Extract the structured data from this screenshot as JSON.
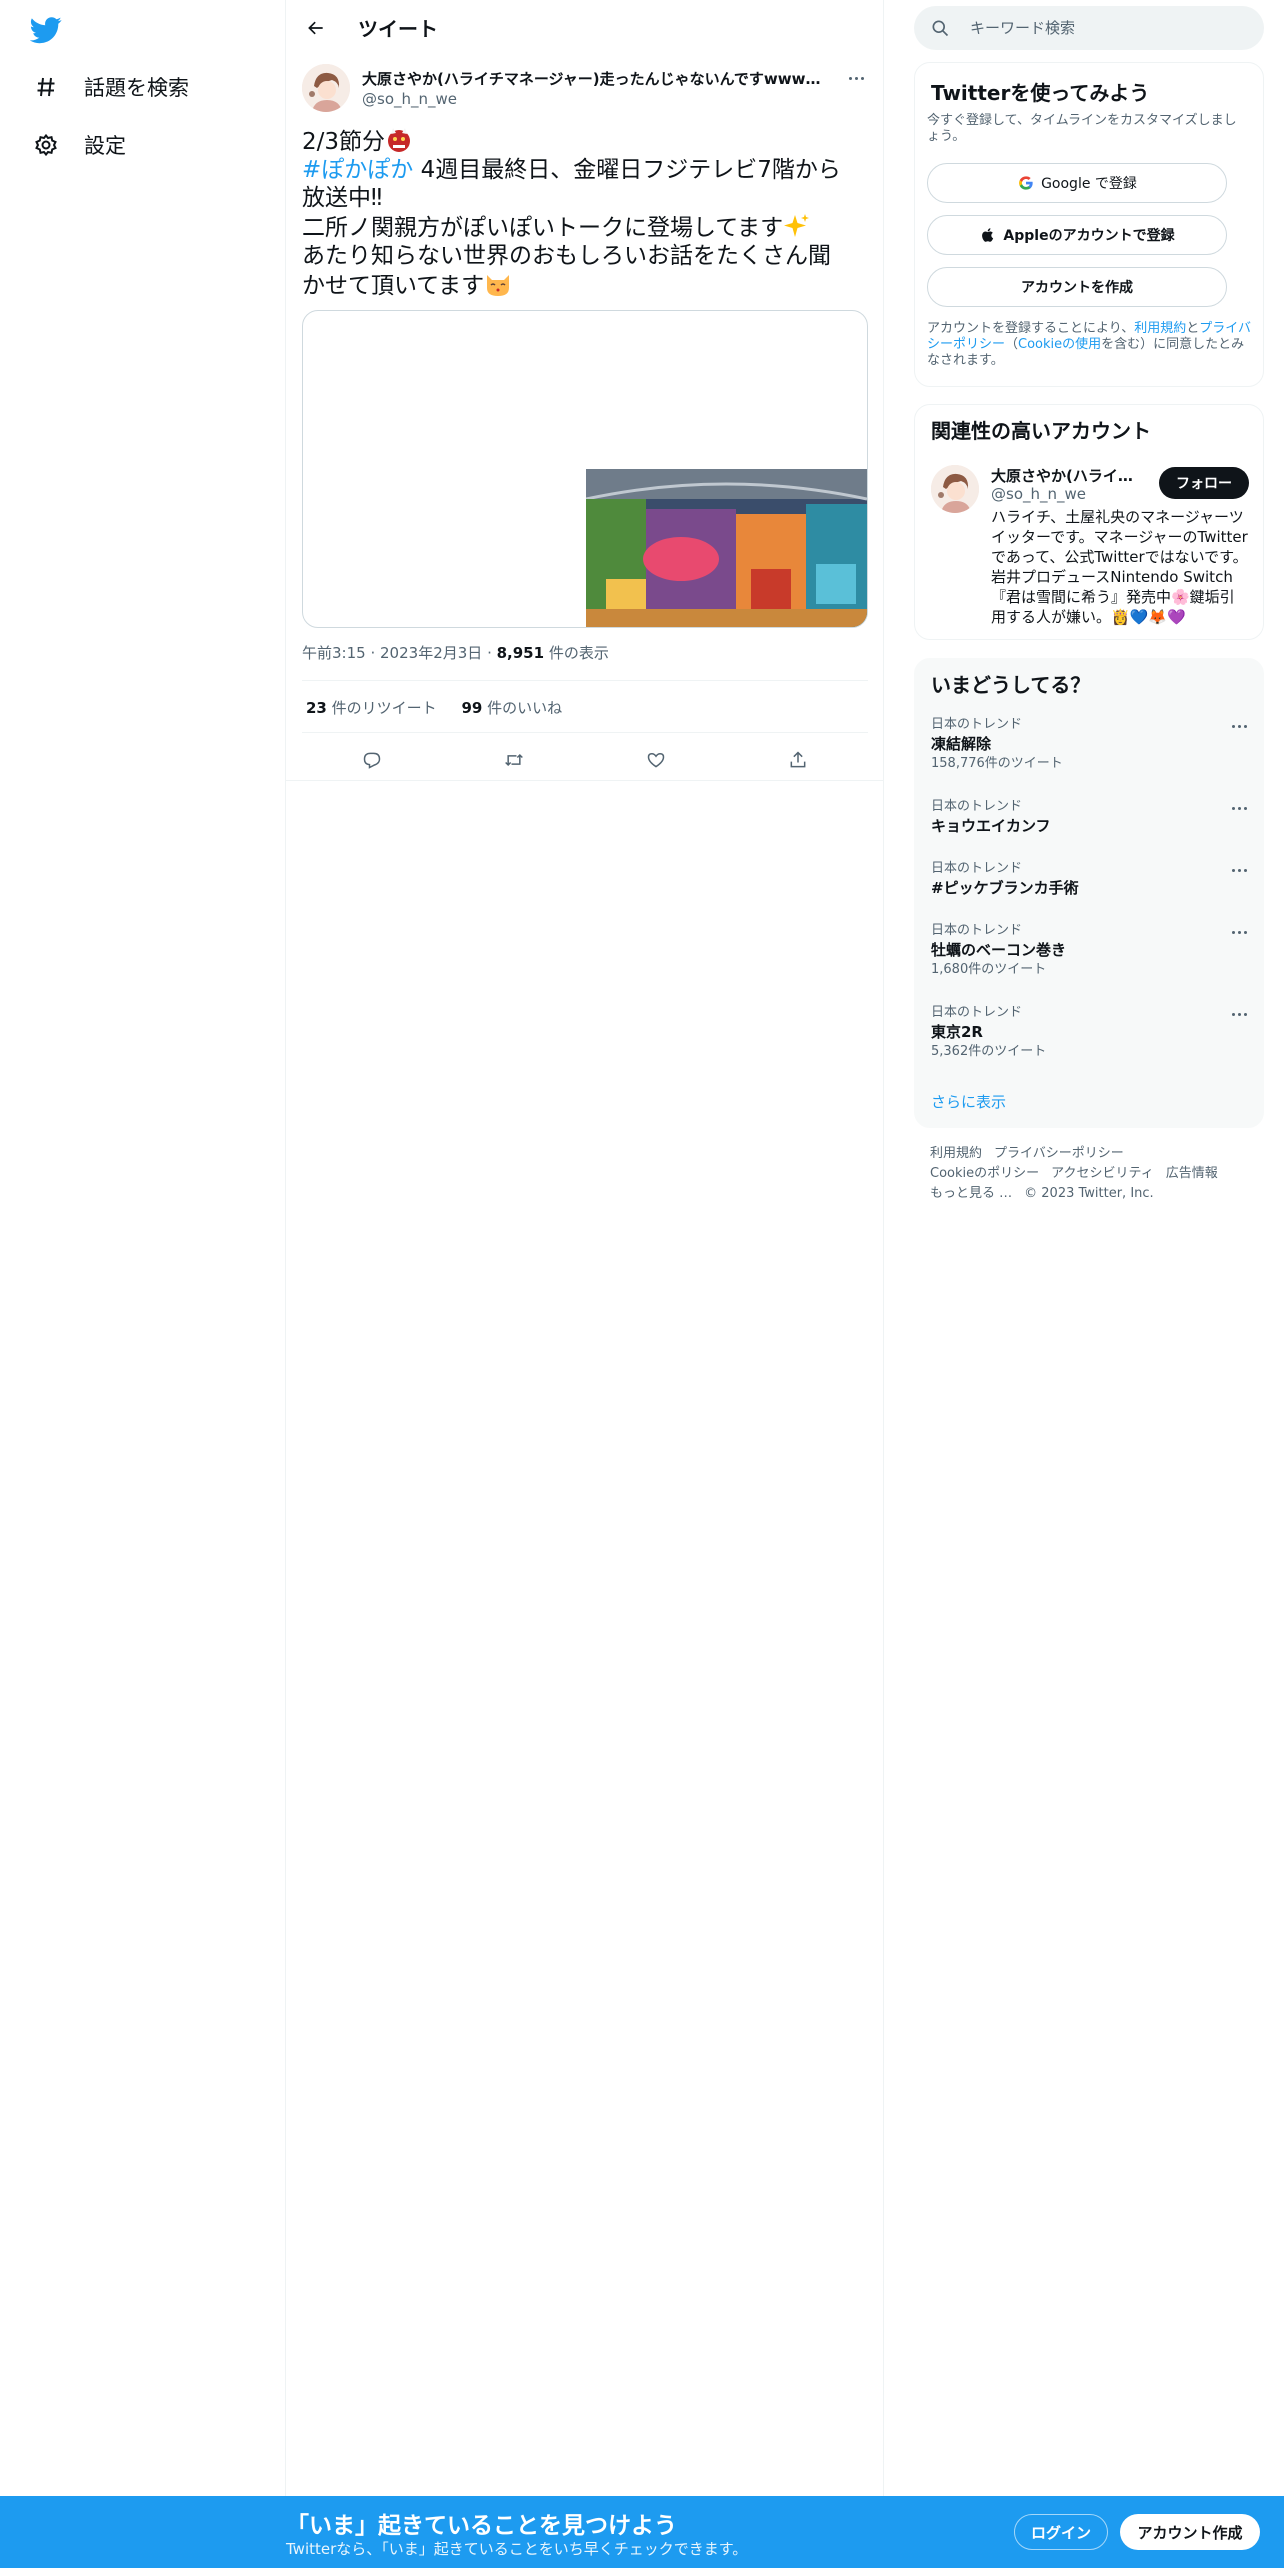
{
  "sidebar": {
    "logo": "twitter-bird-icon",
    "items": [
      {
        "icon": "hashtag-icon",
        "label": "話題を検索"
      },
      {
        "icon": "gear-icon",
        "label": "設定"
      }
    ]
  },
  "header": {
    "back_icon": "arrow-left-icon",
    "title": "ツイート"
  },
  "tweet": {
    "author_name": "大原さやか(ハライチマネージャー)走ったんじゃないんですwwwwwwwwwwwww",
    "author_handle": "@so_h_n_we",
    "text": {
      "line1": "2/3節分",
      "hashtag": "#ぽかぽか",
      "line2_rest": " 4週目最終日、金曜日フジテレビ7階から",
      "line3": "放送中‼",
      "line4": "二所ノ関親方がぽいぽいトークに登場してます",
      "line5": "あたり知らない世界のおもしろいお話をたくさん聞",
      "line6": "かせて頂いてます"
    },
    "time": "午前3:15",
    "date": "2023年2月3日",
    "views_count": "8,951",
    "views_label": "件の表示",
    "retweets_count": "23",
    "retweets_label": "件のリツイート",
    "likes_count": "99",
    "likes_label": "件のいいね"
  },
  "search": {
    "placeholder": "キーワード検索"
  },
  "signup": {
    "title": "Twitterを使ってみよう",
    "description": "今すぐ登録して、タイムラインをカスタマイズしましょう。",
    "google_label": "Google で登録",
    "apple_label": "Appleのアカウントで登録",
    "create_label": "アカウントを作成",
    "terms_prefix": "アカウントを登録することにより、",
    "terms_link": "利用規約",
    "terms_and": "と",
    "privacy_link": "プライバシーポリシー",
    "cookie_open": "（",
    "cookie_link": "Cookieの使用",
    "terms_suffix": "を含む）に同意したとみなされます。"
  },
  "related": {
    "title": "関連性の高いアカウント",
    "name": "大原さやか(ハライチマネージャー)",
    "handle": "@so_h_n_we",
    "follow_label": "フォロー",
    "bio": "ハライチ、土屋礼央のマネージャーツイッターです。マネージャーのTwitterであって、公式Twitterではないです。岩井プロデュースNintendo Switch『君は雪間に希う』発売中🌸鍵垢引用する人が嫌い。👸💙🦊💜"
  },
  "trends": {
    "title": "いまどうしてる？",
    "items": [
      {
        "context": "日本のトレンド",
        "name": "凍結解除",
        "count": "158,776件のツイート"
      },
      {
        "context": "日本のトレンド",
        "name": "キョウエイカンフ",
        "count": ""
      },
      {
        "context": "日本のトレンド",
        "name": "#ピッケブランカ手術",
        "count": ""
      },
      {
        "context": "日本のトレンド",
        "name": "牡蠣のベーコン巻き",
        "count": "1,680件のツイート"
      },
      {
        "context": "日本のトレンド",
        "name": "東京2R",
        "count": "5,362件のツイート"
      }
    ],
    "show_more": "さらに表示"
  },
  "footer": {
    "links": [
      "利用規約",
      "プライバシーポリシー",
      "Cookieのポリシー",
      "アクセシビリティ",
      "広告情報",
      "もっと見る …",
      "© 2023 Twitter, Inc."
    ]
  },
  "banner": {
    "title": "「いま」起きていることを見つけよう",
    "subtitle": "Twitterなら、「いま」起きていることをいち早くチェックできます。",
    "login_label": "ログイン",
    "signup_label": "アカウント作成"
  },
  "colors": {
    "accent": "#1d9bf0",
    "text": "#0f1419",
    "muted": "#536471",
    "border": "#eff3f4",
    "panel": "#f7f9f9"
  }
}
